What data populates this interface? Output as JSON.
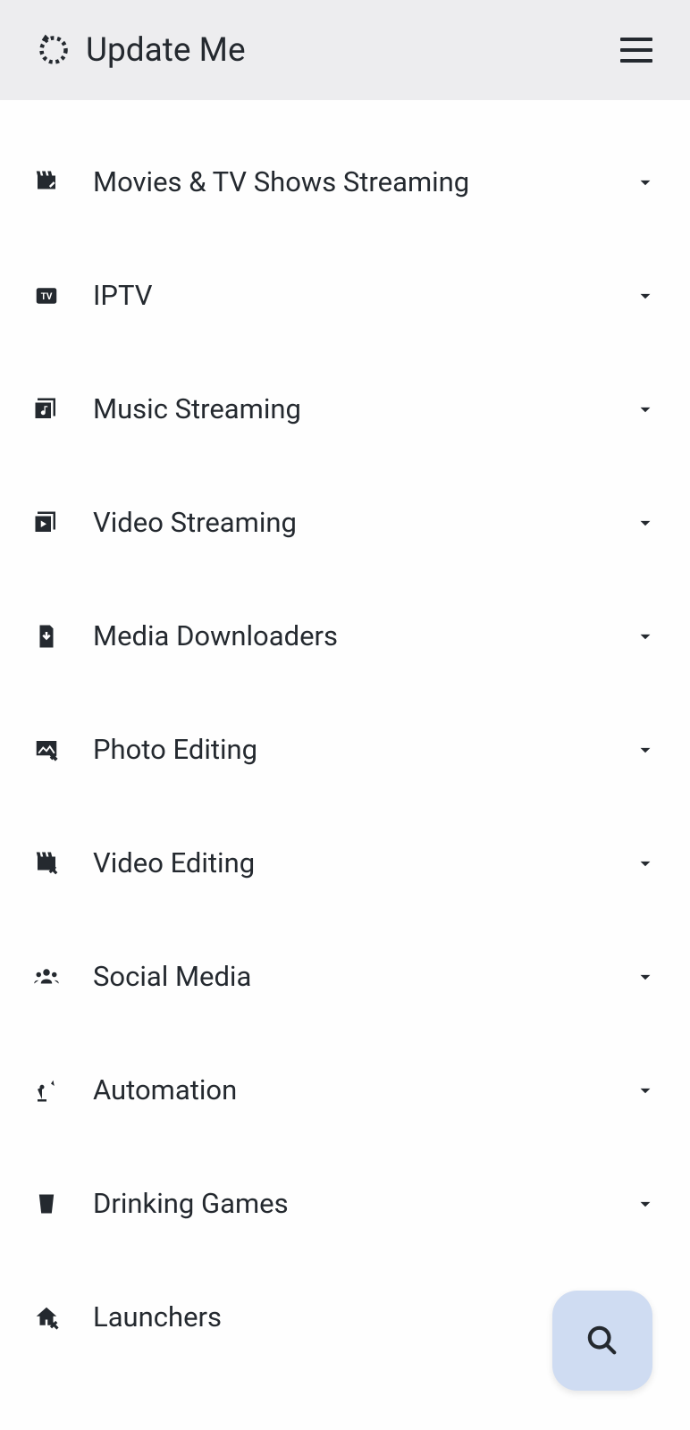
{
  "header": {
    "title": "Update Me"
  },
  "categories": [
    {
      "label": "Movies & TV Shows Streaming",
      "icon": "movie-clap"
    },
    {
      "label": "IPTV",
      "icon": "tv"
    },
    {
      "label": "Music Streaming",
      "icon": "music-library"
    },
    {
      "label": "Video Streaming",
      "icon": "video-library"
    },
    {
      "label": "Media Downloaders",
      "icon": "file-download"
    },
    {
      "label": "Photo Editing",
      "icon": "photo-edit"
    },
    {
      "label": "Video Editing",
      "icon": "video-edit"
    },
    {
      "label": "Social Media",
      "icon": "people"
    },
    {
      "label": "Automation",
      "icon": "robot-arm"
    },
    {
      "label": "Drinking Games",
      "icon": "cup"
    },
    {
      "label": "Launchers",
      "icon": "home-edit"
    }
  ]
}
